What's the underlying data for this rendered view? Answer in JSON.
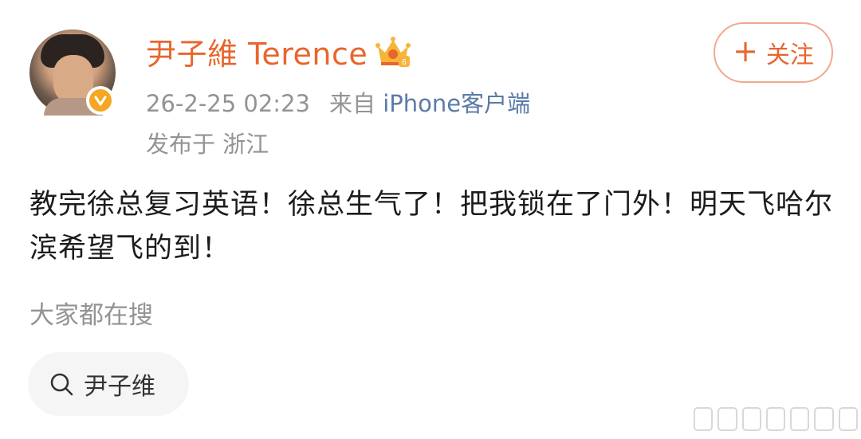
{
  "post": {
    "author_name": "尹子維 Terence",
    "follow_label": "关注",
    "follow_plus": "+",
    "timestamp": "26-2-25 02:23",
    "source_prefix": "来自",
    "source_client": "iPhone客户端",
    "location": "发布于 浙江",
    "content": "教完徐总复习英语！徐总生气了！把我锁在了门外！明天飞哈尔滨希望飞的到！",
    "verified_icon": "verified-badge-icon",
    "vip_icon": "crown-vip-icon"
  },
  "search": {
    "hint": "大家都在搜",
    "tag_label": "尹子维",
    "tag_icon": "search-icon"
  },
  "colors": {
    "brand_orange": "#e8652d",
    "meta_gray": "#939393",
    "source_blue": "#5b7aa8"
  }
}
